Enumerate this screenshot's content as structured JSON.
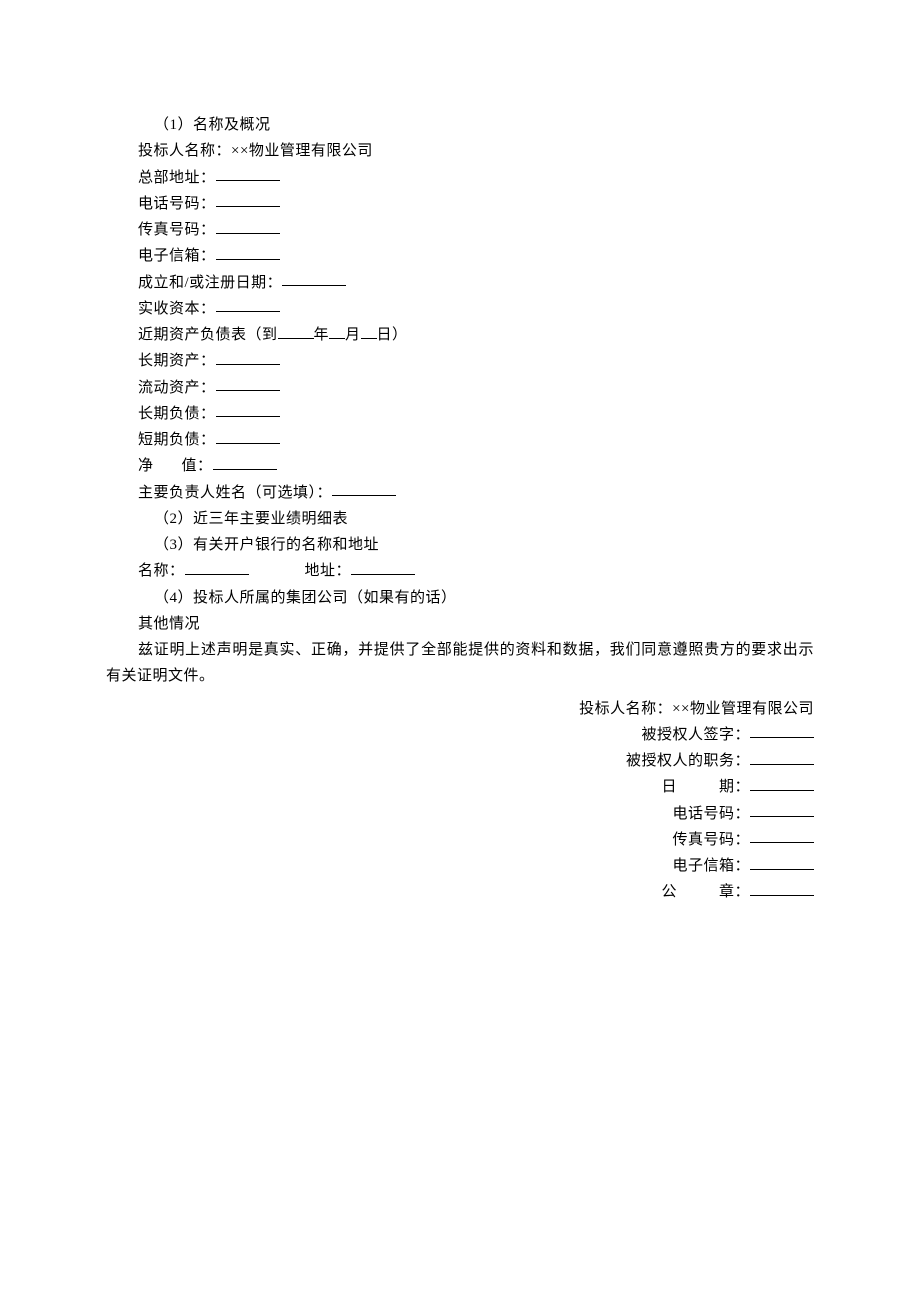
{
  "sec1_title": "（1）名称及概况",
  "bidder_label": "投标人名称：",
  "bidder_value": "××物业管理有限公司",
  "hq_label": "总部地址：",
  "phone_label": "电话号码：",
  "fax_label": "传真号码：",
  "email_label": "电子信箱：",
  "reg_label": "成立和/或注册日期：",
  "capital_label": "实收资本：",
  "balance_pre": "近期资产负债表（到",
  "balance_year": "年",
  "balance_month": "月",
  "balance_day": "日）",
  "long_asset_label": "长期资产：",
  "curr_asset_label": "流动资产：",
  "long_liab_label": "长期负债：",
  "short_liab_label": "短期负债：",
  "net_label_a": "净",
  "net_label_b": "值：",
  "principal_label": "主要负责人姓名（可选填）：",
  "sec2_title": "（2）近三年主要业绩明细表",
  "sec3_title": "（3）有关开户银行的名称和地址",
  "bank_name_label": "名称：",
  "bank_addr_label": "地址：",
  "sec4_title": "（4）投标人所属的集团公司（如果有的话）",
  "other_label": "其他情况",
  "statement": "兹证明上述声明是真实、正确，并提供了全部能提供的资料和数据，我们同意遵照贵方的要求出示有关证明文件。",
  "sig_bidder_label": "投标人名称：",
  "sig_bidder_value": "××物业管理有限公司",
  "sig_auth_sign": "被授权人签字：",
  "sig_auth_title": "被授权人的职务：",
  "sig_date_a": "日",
  "sig_date_b": "期：",
  "sig_phone": "电话号码：",
  "sig_fax": "传真号码：",
  "sig_email": "电子信箱：",
  "sig_seal_a": "公",
  "sig_seal_b": "章："
}
